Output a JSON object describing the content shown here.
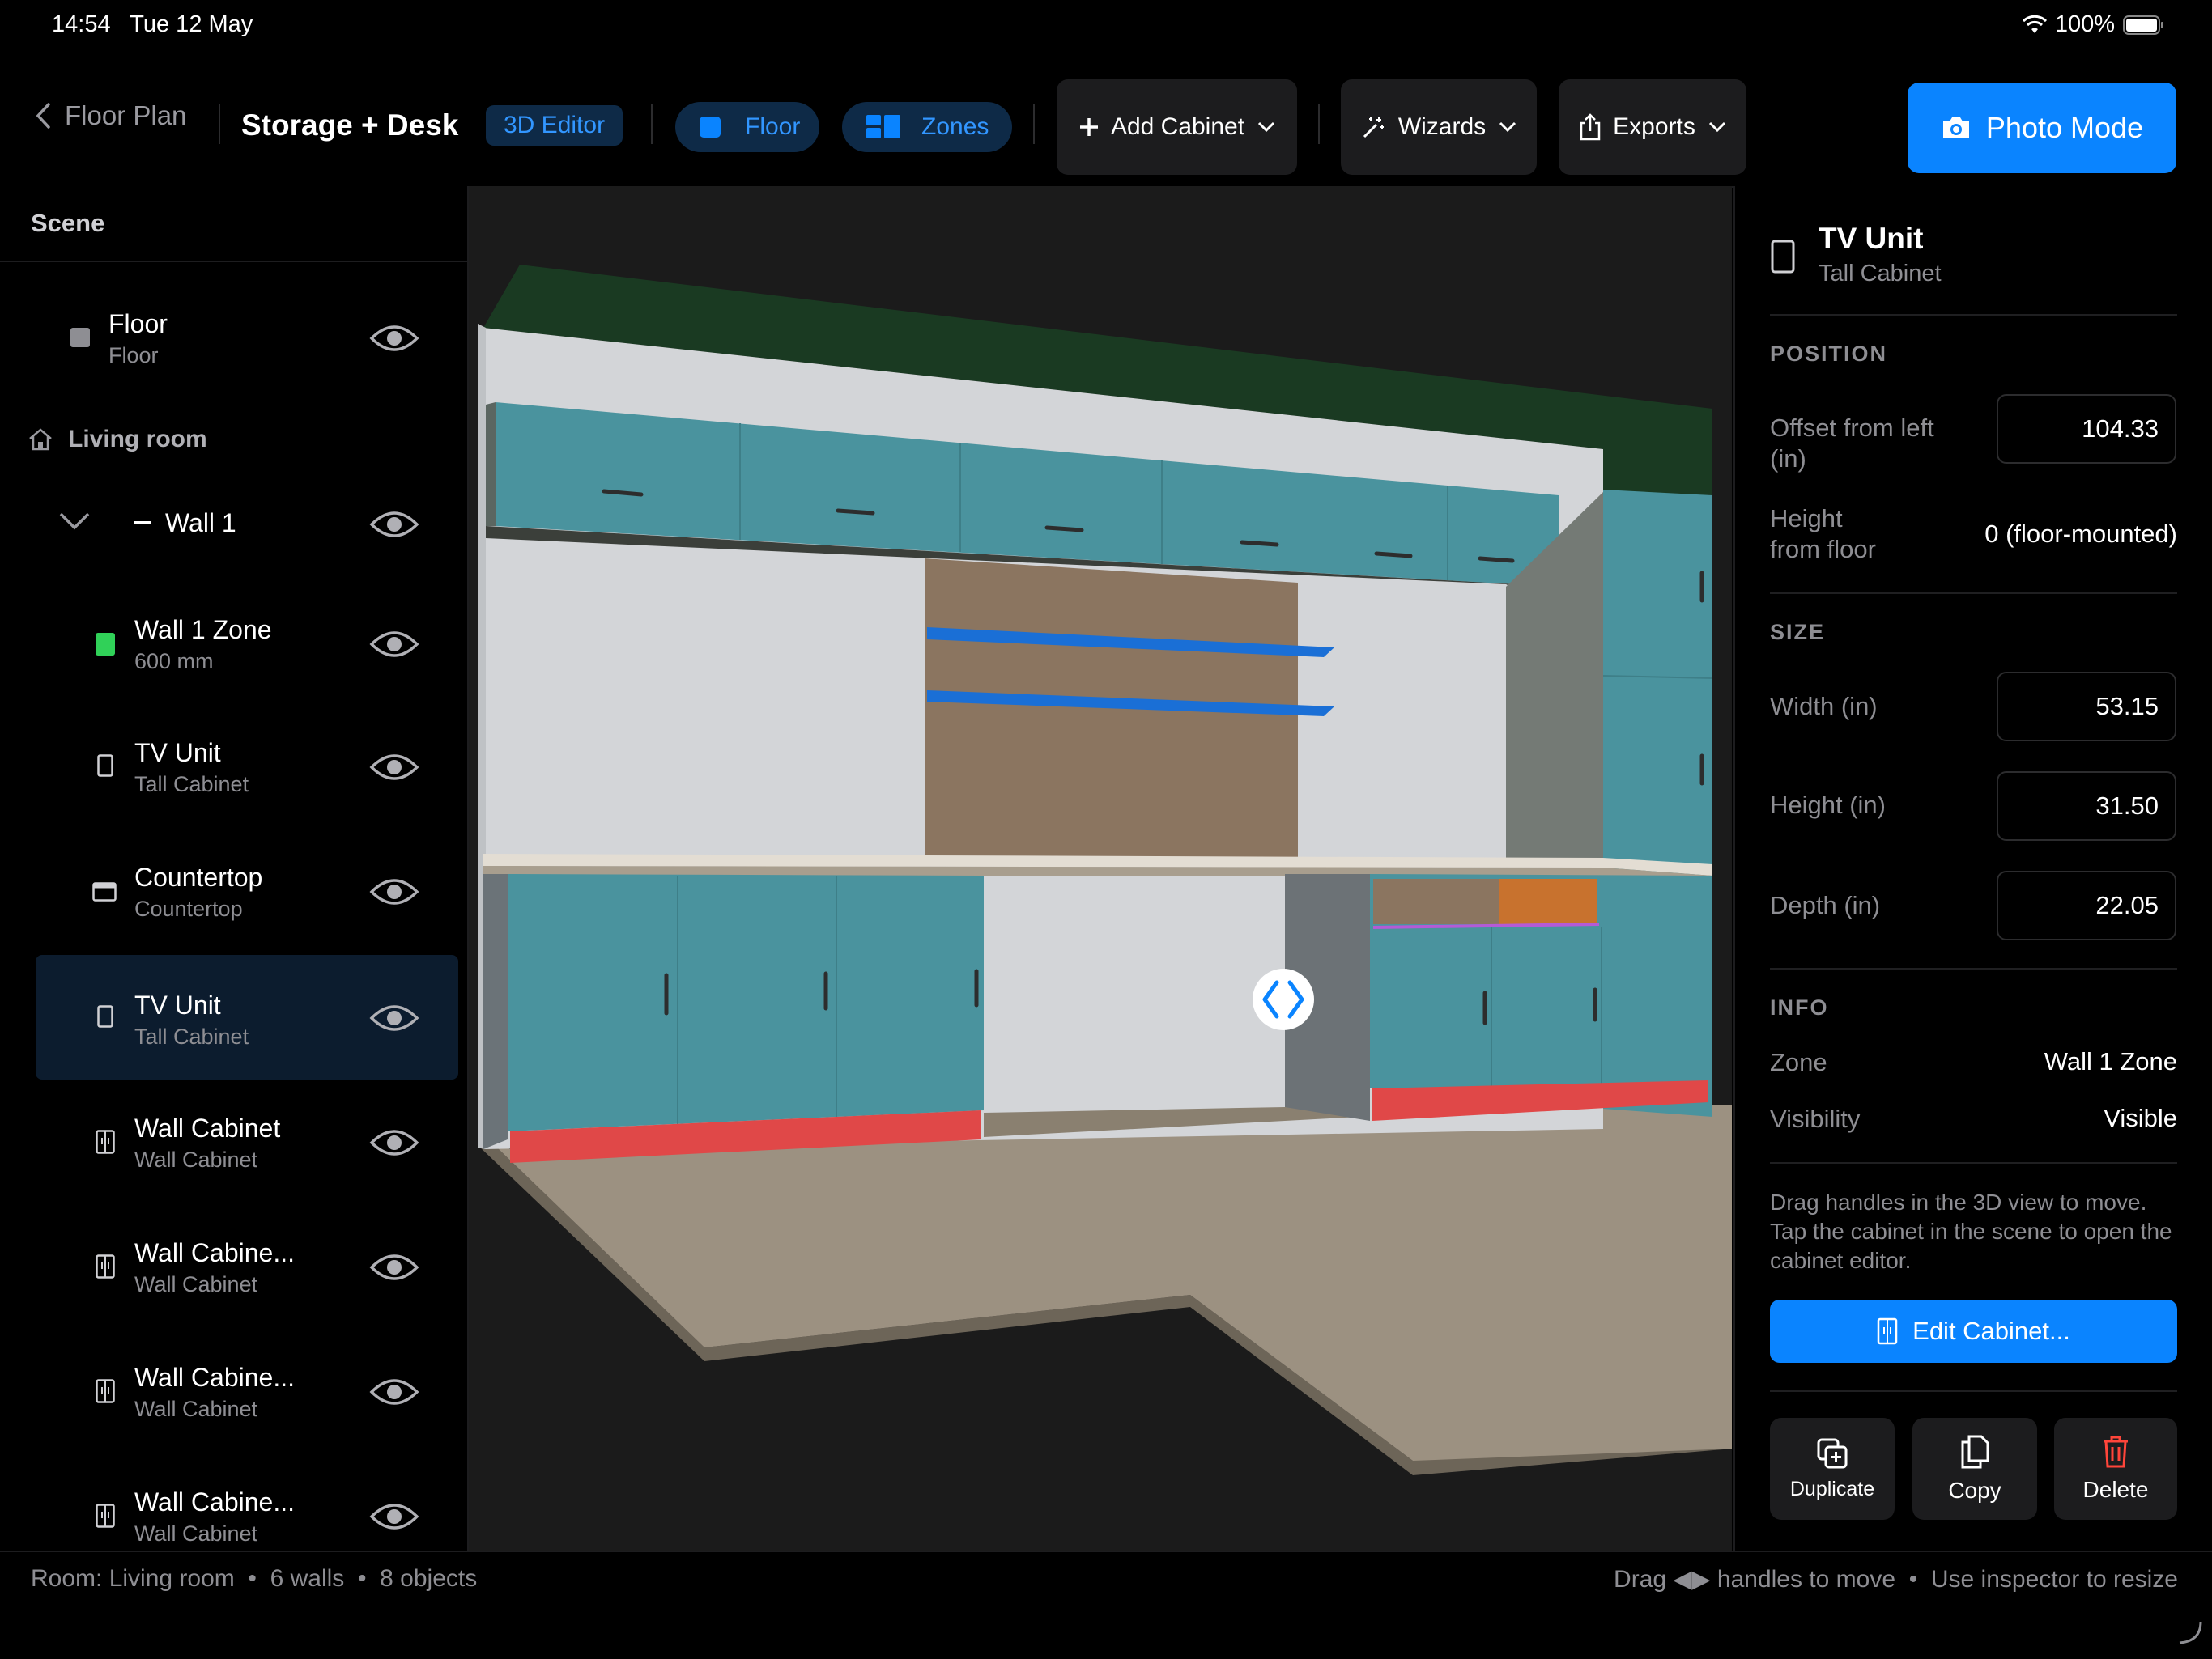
{
  "status_bar": {
    "time": "14:54",
    "date": "Tue 12 May",
    "battery": "100%"
  },
  "toolbar": {
    "back_label": "Floor Plan",
    "project_title": "Storage + Desk",
    "mode_badge": "3D Editor",
    "floor_label": "Floor",
    "zones_label": "Zones",
    "add_cabinet_label": "Add Cabinet",
    "wizards_label": "Wizards",
    "exports_label": "Exports",
    "photo_mode_label": "Photo Mode"
  },
  "scene": {
    "title": "Scene",
    "room_label": "Living room",
    "items": [
      {
        "title": "Floor",
        "subtitle": "Floor",
        "icon": "floor-square-icon"
      },
      {
        "title": "Wall 1",
        "icon": "wall-dash-icon"
      },
      {
        "title": "Wall 1 Zone",
        "subtitle": "600 mm",
        "icon": "zone-green-icon"
      },
      {
        "title": "TV Unit",
        "subtitle": "Tall Cabinet",
        "icon": "tall-cabinet-icon"
      },
      {
        "title": "Countertop",
        "subtitle": "Countertop",
        "icon": "countertop-icon"
      },
      {
        "title": "TV Unit",
        "subtitle": "Tall Cabinet",
        "icon": "tall-cabinet-icon",
        "selected": true
      },
      {
        "title": "Wall Cabinet",
        "subtitle": "Wall Cabinet",
        "icon": "wall-cabinet-icon"
      },
      {
        "title": "Wall Cabine...",
        "subtitle": "Wall Cabinet",
        "icon": "wall-cabinet-icon"
      },
      {
        "title": "Wall Cabine...",
        "subtitle": "Wall Cabinet",
        "icon": "wall-cabinet-icon"
      },
      {
        "title": "Wall Cabine...",
        "subtitle": "Wall Cabinet",
        "icon": "wall-cabinet-icon"
      }
    ]
  },
  "inspector": {
    "title": "TV Unit",
    "subtitle": "Tall Cabinet",
    "position_header": "POSITION",
    "offset_label": "Offset from left (in)",
    "offset_value": "104.33",
    "height_floor_label": "Height from floor",
    "height_floor_value": "0 (floor-mounted)",
    "size_header": "SIZE",
    "width_label": "Width (in)",
    "width_value": "53.15",
    "height_label": "Height (in)",
    "height_value": "31.50",
    "depth_label": "Depth (in)",
    "depth_value": "22.05",
    "info_header": "INFO",
    "zone_label": "Zone",
    "zone_value": "Wall 1 Zone",
    "visibility_label": "Visibility",
    "visibility_value": "Visible",
    "hint": "Drag handles in the 3D view to move. Tap the cabinet in the scene to open the cabinet editor.",
    "edit_button": "Edit Cabinet...",
    "duplicate_label": "Duplicate",
    "copy_label": "Copy",
    "delete_label": "Delete"
  },
  "bottom_bar": {
    "room_info": "Room: Living room  •  6 walls  •  8 objects",
    "hint": "Drag ◀▶ handles to move  •  Use inspector to resize"
  },
  "colors": {
    "accent": "#0a84ff",
    "cabinet_teal": "#4a939e",
    "toe_kick_red": "#e04848",
    "shelf_blue": "#1a6fd6",
    "delete_red": "#ff453a"
  }
}
